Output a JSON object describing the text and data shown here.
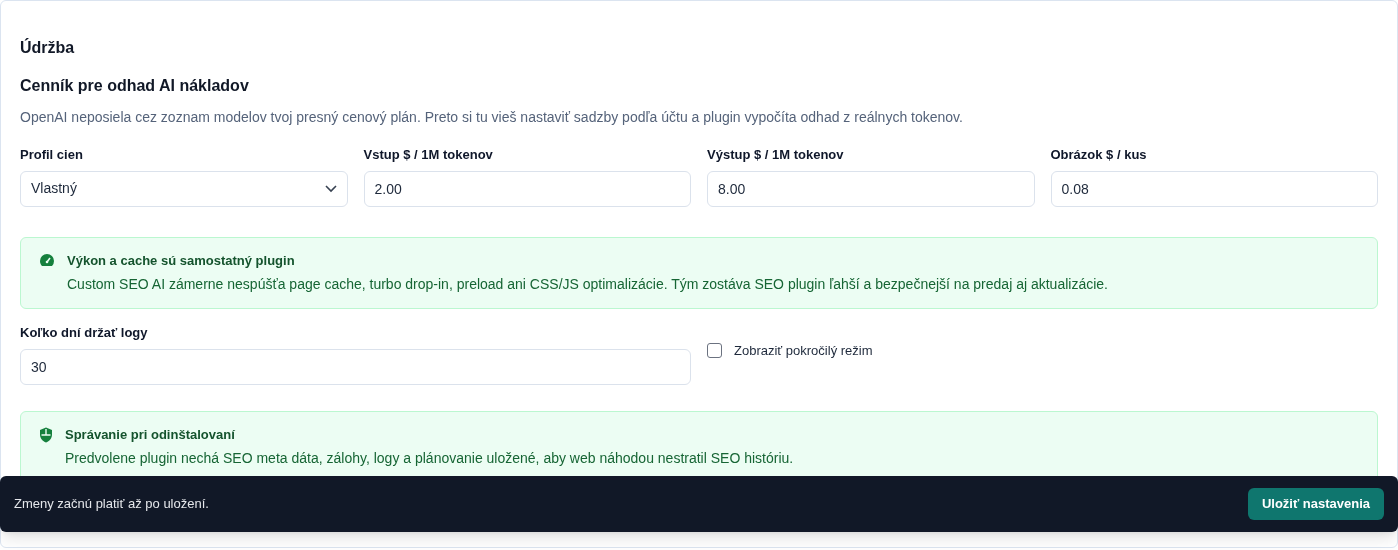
{
  "section_title": "Údržba",
  "pricing": {
    "title": "Cenník pre odhad AI nákladov",
    "description": "OpenAI neposiela cez zoznam modelov tvoj presný cenový plán. Preto si tu vieš nastaviť sadzby podľa účtu a plugin vypočíta odhad z reálnych tokenov.",
    "fields": [
      {
        "kind": "select",
        "label": "Profil cien",
        "value": "Vlastný"
      },
      {
        "kind": "input",
        "label": "Vstup $ / 1M tokenov",
        "value": "2.00"
      },
      {
        "kind": "input",
        "label": "Výstup $ / 1M tokenov",
        "value": "8.00"
      },
      {
        "kind": "input",
        "label": "Obrázok $ / kus",
        "value": "0.08"
      }
    ]
  },
  "performance_notice": {
    "title": "Výkon a cache sú samostatný plugin",
    "text": "Custom SEO AI zámerne nespúšťa page cache, turbo drop-in, preload ani CSS/JS optimalizácie. Tým zostáva SEO plugin ľahší a bezpečnejší na predaj aj aktualizácie."
  },
  "log_days": {
    "label": "Koľko dní držať logy",
    "value": "30"
  },
  "advanced_mode": {
    "label": "Zobraziť pokročilý režim",
    "checked": false
  },
  "uninstall_notice": {
    "title": "Správanie pri odinštalovaní",
    "text": "Predvolene plugin nechá SEO meta dáta, zálohy, logy a plánovanie uložené, aby web náhodou nestratil SEO históriu."
  },
  "save_bar": {
    "message": "Zmeny začnú platiť až po uložení.",
    "button": "Uložiť nastavenia"
  }
}
